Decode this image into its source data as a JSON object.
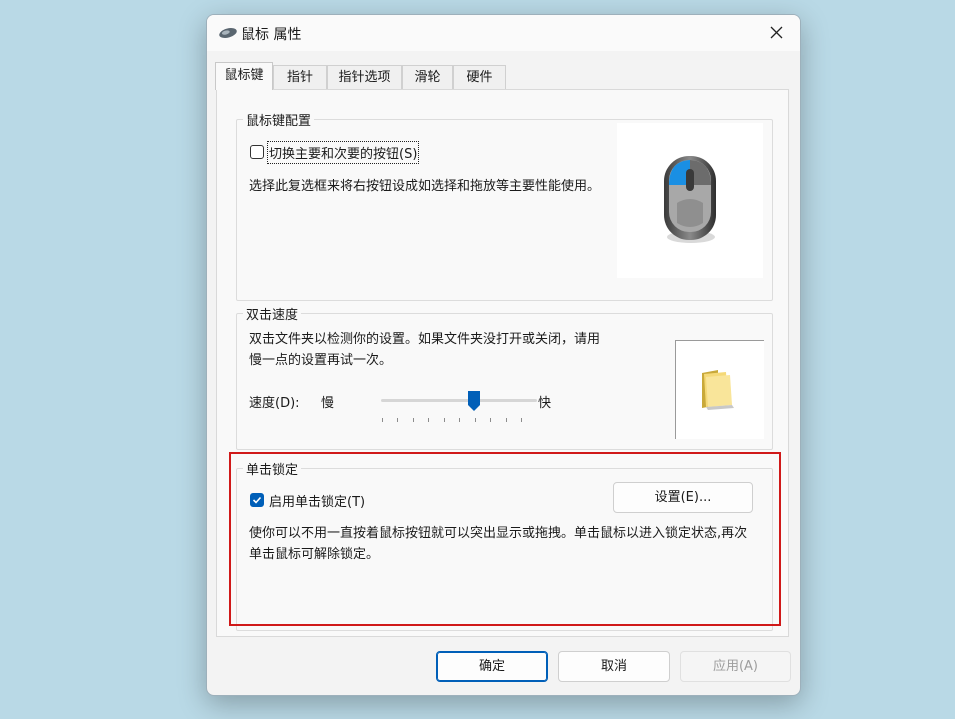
{
  "window": {
    "title": "鼠标 属性",
    "icon": "mouse-icon"
  },
  "tabs": [
    {
      "label": "鼠标键",
      "active": true
    },
    {
      "label": "指针",
      "active": false
    },
    {
      "label": "指针选项",
      "active": false
    },
    {
      "label": "滑轮",
      "active": false
    },
    {
      "label": "硬件",
      "active": false
    }
  ],
  "button_config": {
    "legend": "鼠标键配置",
    "swap_checkbox": {
      "label": "切换主要和次要的按钮(S)",
      "checked": false
    },
    "description": "选择此复选框来将右按钮设成如选择和拖放等主要性能使用。",
    "preview_icon": "mouse-illustration"
  },
  "double_click": {
    "legend": "双击速度",
    "description": "双击文件夹以检测你的设置。如果文件夹没打开或关闭，请用慢一点的设置再试一次。",
    "speed_label": "速度(D):",
    "slow_label": "慢",
    "fast_label": "快",
    "speed_setting": {
      "position": 6,
      "max": 10
    },
    "test_icon": "folder-icon"
  },
  "click_lock": {
    "legend": "单击锁定",
    "enable_checkbox": {
      "label": "启用单击锁定(T)",
      "checked": true
    },
    "settings_button": "设置(E)...",
    "description": "使你可以不用一直按着鼠标按钮就可以突出显示或拖拽。单击鼠标以进入锁定状态,再次单击鼠标可解除锁定。"
  },
  "footer": {
    "ok": "确定",
    "cancel": "取消",
    "apply": "应用(A)"
  },
  "colors": {
    "accent": "#005fb8",
    "highlight_border": "#d01919",
    "desktop": "#b9d9e6"
  }
}
